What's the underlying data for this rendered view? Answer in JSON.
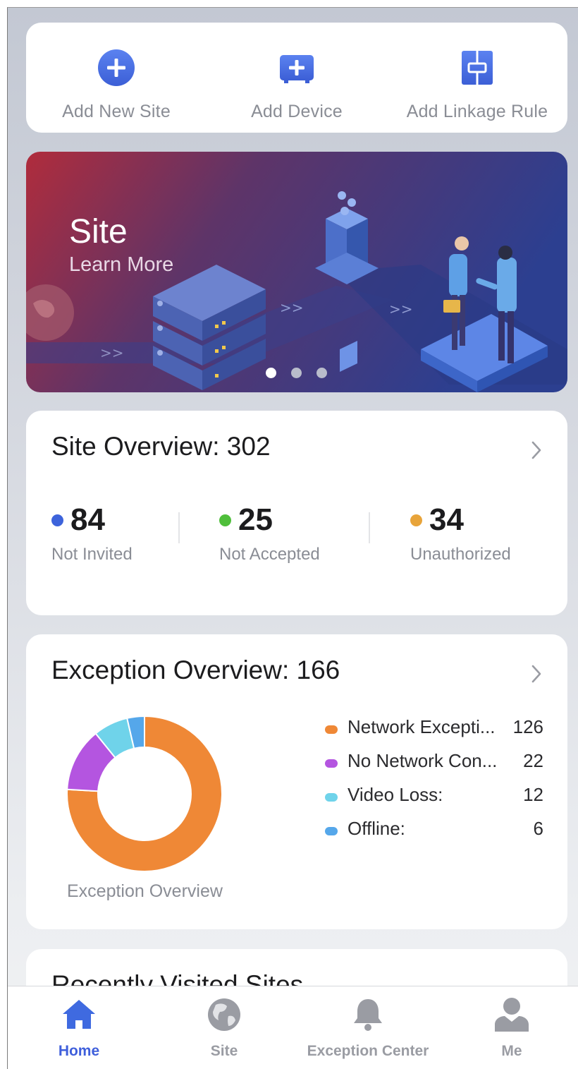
{
  "quick_actions": [
    {
      "label": "Add New Site",
      "icon": "add-site-icon"
    },
    {
      "label": "Add Device",
      "icon": "add-device-icon"
    },
    {
      "label": "Add Linkage Rule",
      "icon": "linkage-rule-icon"
    }
  ],
  "banner": {
    "title": "Site",
    "subtitle": "Learn More",
    "page_count": 3,
    "active_page": 1
  },
  "site_overview": {
    "title": "Site Overview: 302",
    "stats": [
      {
        "value": "84",
        "label": "Not Invited",
        "color": "#3d63db"
      },
      {
        "value": "25",
        "label": "Not Accepted",
        "color": "#4fbf3b"
      },
      {
        "value": "34",
        "label": "Unauthorized",
        "color": "#e8a43a"
      }
    ]
  },
  "exception_overview": {
    "title": "Exception Overview: 166",
    "chart_caption": "Exception Overview",
    "items": [
      {
        "name": "Network Excepti...",
        "value": "126",
        "color": "#ef8836"
      },
      {
        "name": "No Network Con...",
        "value": "22",
        "color": "#b455e0"
      },
      {
        "name": "Video Loss:",
        "value": "12",
        "color": "#6fd3ea"
      },
      {
        "name": "Offline:",
        "value": "6",
        "color": "#55a7ea"
      }
    ]
  },
  "chart_data": {
    "type": "pie",
    "title": "",
    "categories": [
      "Network Excepti...",
      "No Network Con...",
      "Video Loss:",
      "Offline:"
    ],
    "values": [
      126,
      22,
      12,
      6
    ],
    "colors": [
      "#ef8836",
      "#b455e0",
      "#6fd3ea",
      "#55a7ea"
    ],
    "donut": true,
    "caption": "Exception Overview"
  },
  "recent": {
    "title": "Recently Visited Sites"
  },
  "tabbar": {
    "active": "Home",
    "active_color": "#3f5fdb",
    "items": [
      {
        "label": "Home",
        "icon": "home-icon"
      },
      {
        "label": "Site",
        "icon": "globe-icon"
      },
      {
        "label": "Exception Center",
        "icon": "bell-icon"
      },
      {
        "label": "Me",
        "icon": "user-icon"
      }
    ]
  }
}
